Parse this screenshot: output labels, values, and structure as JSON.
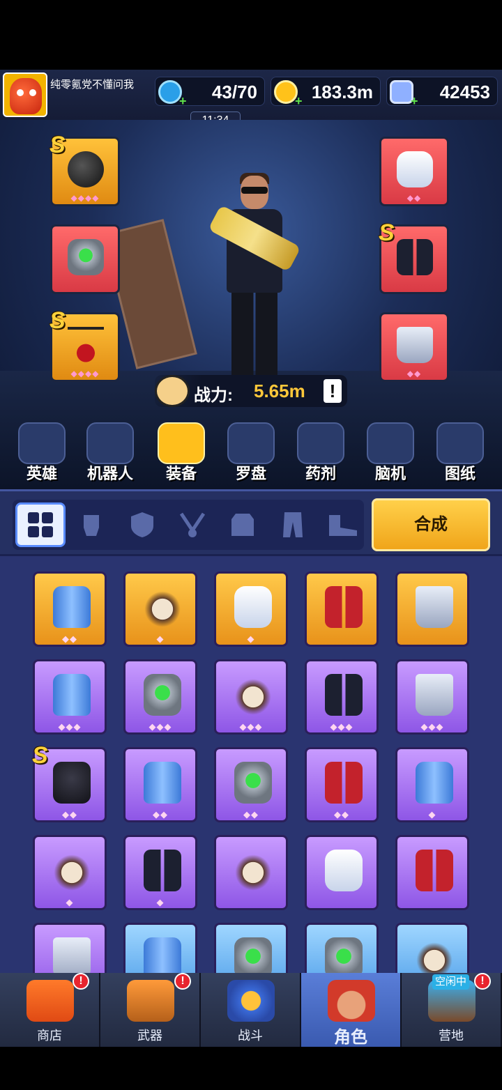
{
  "player": {
    "name": "纯零氪党不懂问我"
  },
  "resources": {
    "energy": "43/70",
    "coins": "183.3m",
    "gems": "42453",
    "timer": "11:34"
  },
  "power": {
    "label": "战力:",
    "value": "5.65m",
    "alert": "!"
  },
  "categories": [
    "英雄",
    "机器人",
    "装备",
    "罗盘",
    "药剂",
    "脑机",
    "图纸"
  ],
  "active_category": "装备",
  "filter_icons": [
    "grid-icon",
    "glove-icon",
    "shield-icon",
    "necklace-icon",
    "vest-icon",
    "pants-icon",
    "boot-icon"
  ],
  "craft_label": "合成",
  "equipped_left": [
    {
      "rarity": "gold",
      "s_mark": "S",
      "gems": "◆◆◆◆",
      "icon": "bomb-icon"
    },
    {
      "rarity": "red",
      "s_mark": "",
      "gems": "",
      "icon": "shield-icon"
    },
    {
      "rarity": "gold",
      "s_mark": "S",
      "gems": "◆◆◆◆",
      "icon": "necklace-icon"
    }
  ],
  "equipped_right": [
    {
      "rarity": "red",
      "s_mark": "",
      "gems": "◆◆",
      "icon": "jacket-icon"
    },
    {
      "rarity": "red",
      "s_mark": "S",
      "gems": "",
      "icon": "pants-icon"
    },
    {
      "rarity": "red",
      "s_mark": "",
      "gems": "◆◆",
      "icon": "boots-icon"
    }
  ],
  "inventory": [
    {
      "rarity": "gold",
      "art": "grenade",
      "gems": "◆◆",
      "s_mark": ""
    },
    {
      "rarity": "gold",
      "art": "skull",
      "gems": "◆",
      "s_mark": ""
    },
    {
      "rarity": "gold",
      "art": "jacket",
      "gems": "◆",
      "s_mark": ""
    },
    {
      "rarity": "gold",
      "art": "pants-red",
      "gems": "",
      "s_mark": ""
    },
    {
      "rarity": "gold",
      "art": "boots",
      "gems": "",
      "s_mark": ""
    },
    {
      "rarity": "purple",
      "art": "grenade",
      "gems": "◆◆◆",
      "s_mark": ""
    },
    {
      "rarity": "purple",
      "art": "shield",
      "gems": "◆◆◆",
      "s_mark": ""
    },
    {
      "rarity": "purple",
      "art": "skull",
      "gems": "◆◆◆",
      "s_mark": ""
    },
    {
      "rarity": "purple",
      "art": "pants-black",
      "gems": "◆◆◆",
      "s_mark": ""
    },
    {
      "rarity": "purple",
      "art": "boots",
      "gems": "◆◆◆",
      "s_mark": ""
    },
    {
      "rarity": "purple",
      "art": "armor",
      "gems": "◆◆",
      "s_mark": "S"
    },
    {
      "rarity": "purple",
      "art": "grenade",
      "gems": "◆◆",
      "s_mark": ""
    },
    {
      "rarity": "purple",
      "art": "shield",
      "gems": "◆◆",
      "s_mark": ""
    },
    {
      "rarity": "purple",
      "art": "pants-red",
      "gems": "◆◆",
      "s_mark": ""
    },
    {
      "rarity": "purple",
      "art": "grenade",
      "gems": "◆",
      "s_mark": ""
    },
    {
      "rarity": "purple",
      "art": "skull",
      "gems": "◆",
      "s_mark": ""
    },
    {
      "rarity": "purple",
      "art": "pants-black",
      "gems": "◆",
      "s_mark": ""
    },
    {
      "rarity": "purple",
      "art": "skull",
      "gems": "",
      "s_mark": ""
    },
    {
      "rarity": "purple",
      "art": "jacket",
      "gems": "",
      "s_mark": ""
    },
    {
      "rarity": "purple",
      "art": "pants-red",
      "gems": "",
      "s_mark": ""
    },
    {
      "rarity": "purple",
      "art": "boots",
      "gems": "",
      "s_mark": ""
    },
    {
      "rarity": "blue",
      "art": "grenade",
      "gems": "",
      "s_mark": ""
    },
    {
      "rarity": "blue",
      "art": "shield",
      "gems": "",
      "s_mark": ""
    },
    {
      "rarity": "blue",
      "art": "shield",
      "gems": "",
      "s_mark": ""
    },
    {
      "rarity": "blue",
      "art": "skull",
      "gems": "",
      "s_mark": ""
    }
  ],
  "tabs": [
    {
      "label": "商店",
      "alert": "!",
      "badge": ""
    },
    {
      "label": "武器",
      "alert": "!",
      "badge": ""
    },
    {
      "label": "战斗",
      "alert": "",
      "badge": ""
    },
    {
      "label": "角色",
      "alert": "",
      "badge": ""
    },
    {
      "label": "营地",
      "alert": "!",
      "badge": "空闲中"
    }
  ],
  "active_tab": "角色",
  "colors": {
    "gold": "#ffc23a",
    "purple": "#a774f2",
    "red": "#e8454f",
    "blue": "#6cb4f2",
    "power_value": "#ffc83a"
  }
}
